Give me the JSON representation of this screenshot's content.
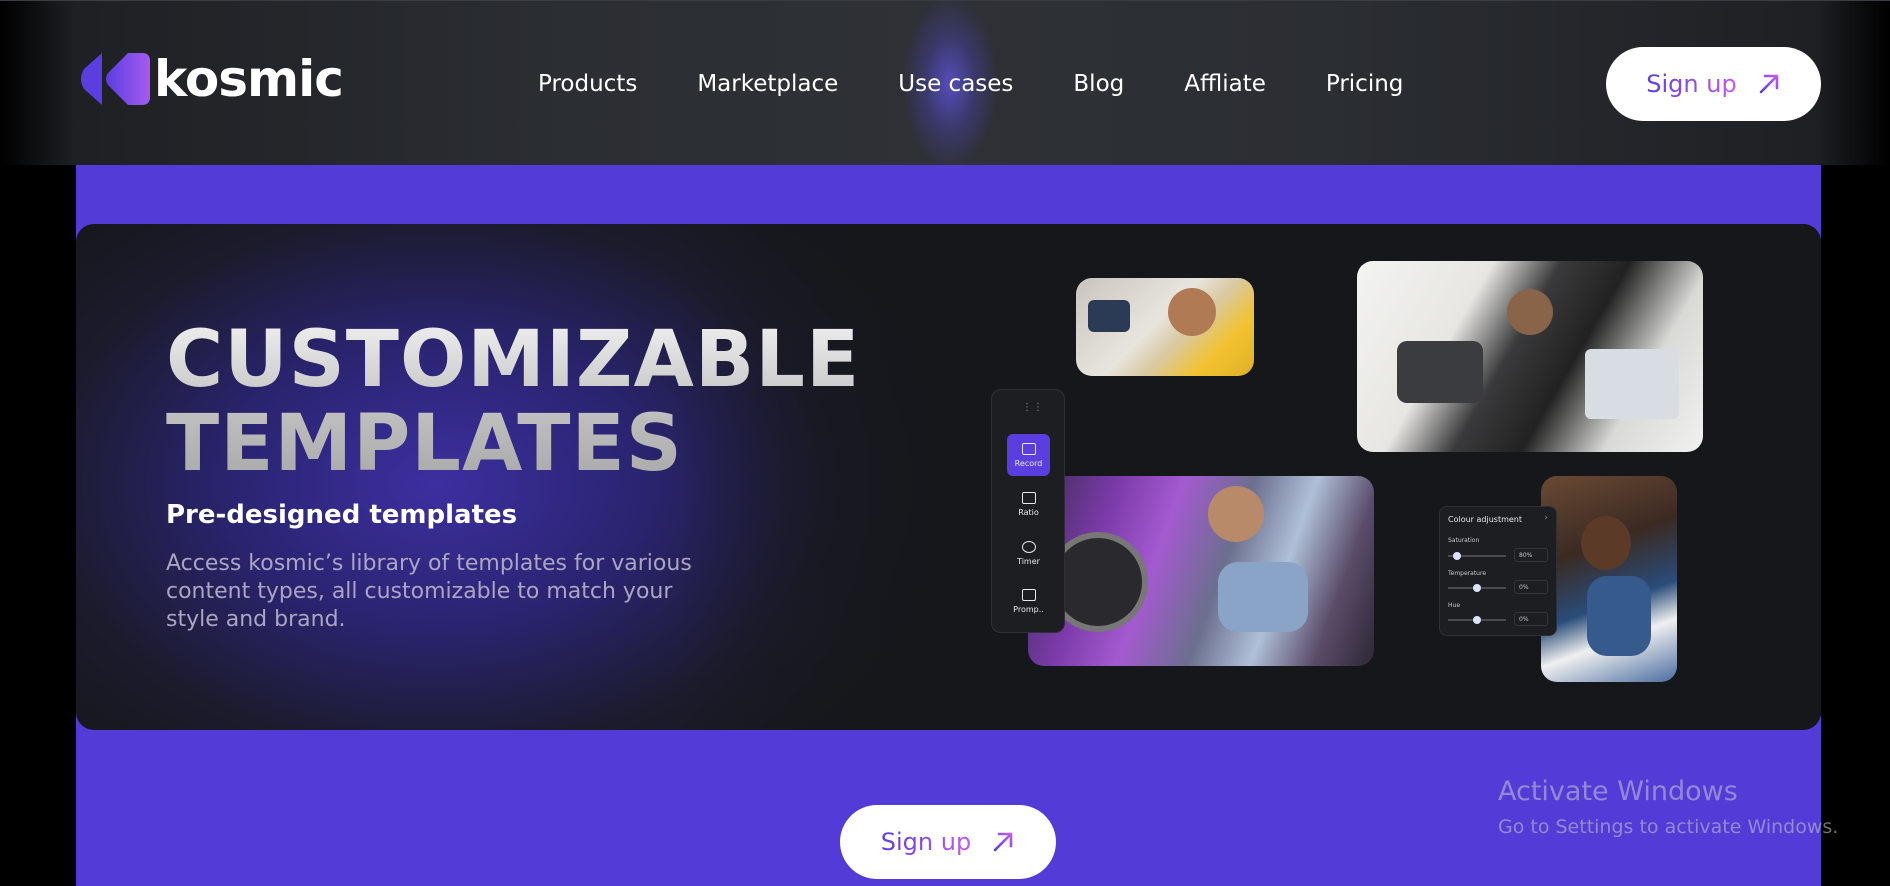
{
  "header": {
    "brand": "kosmic",
    "nav": [
      "Products",
      "Marketplace",
      "Use cases",
      "Blog",
      "Affliate",
      "Pricing"
    ],
    "signup_label": "Sign up"
  },
  "hero": {
    "title_line1": "CUSTOMIZABLE",
    "title_line2": "TEMPLATES",
    "subtitle": "Pre-designed templates",
    "description": "Access kosmic’s library of templates for various content types, all customizable to match your style and brand."
  },
  "toolbar": {
    "items": [
      {
        "label": "Record",
        "icon": "monitor-icon",
        "active": true
      },
      {
        "label": "Ratio",
        "icon": "ratio-icon",
        "active": false
      },
      {
        "label": "Timer",
        "icon": "timer-icon",
        "active": false
      },
      {
        "label": "Promp..",
        "icon": "prompter-icon",
        "active": false
      }
    ]
  },
  "colour_panel": {
    "title": "Colour adjustment",
    "rows": [
      {
        "label": "Saturation",
        "value": "80%",
        "level": 0.1
      },
      {
        "label": "Temperature",
        "value": "0%",
        "level": 0.5
      },
      {
        "label": "Hue",
        "value": "0%",
        "level": 0.5
      }
    ]
  },
  "cta": {
    "signup_label": "Sign up"
  },
  "watermark": {
    "title": "Activate Windows",
    "subtitle": "Go to Settings to activate Windows."
  },
  "colors": {
    "accent": "#533bd8",
    "header_bg": "#2e3136",
    "card_bg": "#16171b",
    "gradient_start": "#5b3ee0",
    "gradient_end": "#c25cf0"
  }
}
